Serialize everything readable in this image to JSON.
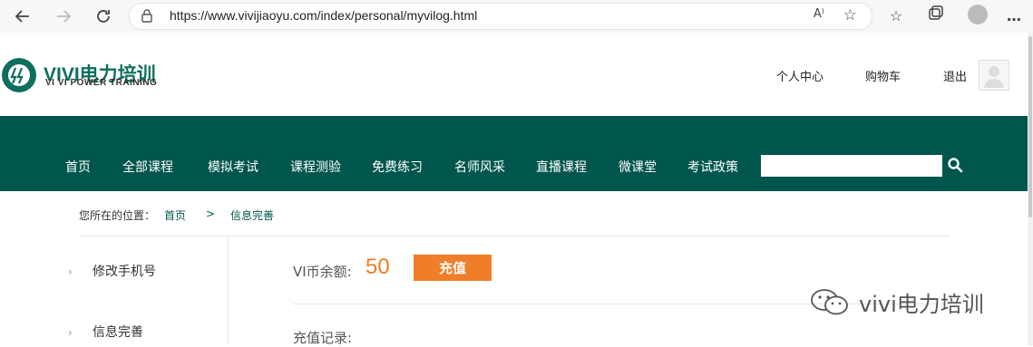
{
  "browser": {
    "url": "https://www.vivijiaoyu.com/index/personal/myvilog.html",
    "icons": [
      "back-icon",
      "forward-icon",
      "refresh-icon",
      "lock-icon",
      "read-aloud-icon",
      "favorite-add-icon",
      "favorites-icon",
      "collections-icon",
      "profile-icon",
      "more-icon"
    ],
    "read_aloud_label": "A⁾",
    "more_label": "…"
  },
  "header": {
    "logo_title": "VIVI电力培训",
    "logo_subtitle": "VI VI POWER TRAINING",
    "links": [
      "个人中心",
      "购物车",
      "退出"
    ]
  },
  "nav": {
    "items": [
      "首页",
      "全部课程",
      "模拟考试",
      "课程测验",
      "免费练习",
      "名师风采",
      "直播课程",
      "微课堂",
      "考试政策"
    ],
    "search_placeholder": ""
  },
  "breadcrumb": {
    "prefix": "您所在的位置：",
    "home": "首页",
    "separator": ">",
    "current": "信息完善"
  },
  "sidebar": {
    "items": [
      "修改手机号",
      "信息完善"
    ]
  },
  "content": {
    "balance_label": "VI币余额:",
    "balance_value": "50",
    "recharge_button": "充值",
    "records_label": "充值记录:"
  },
  "watermark": {
    "text": "vivi电力培训"
  },
  "colors": {
    "brand_green": "#00564d",
    "accent_orange": "#f07d28"
  }
}
